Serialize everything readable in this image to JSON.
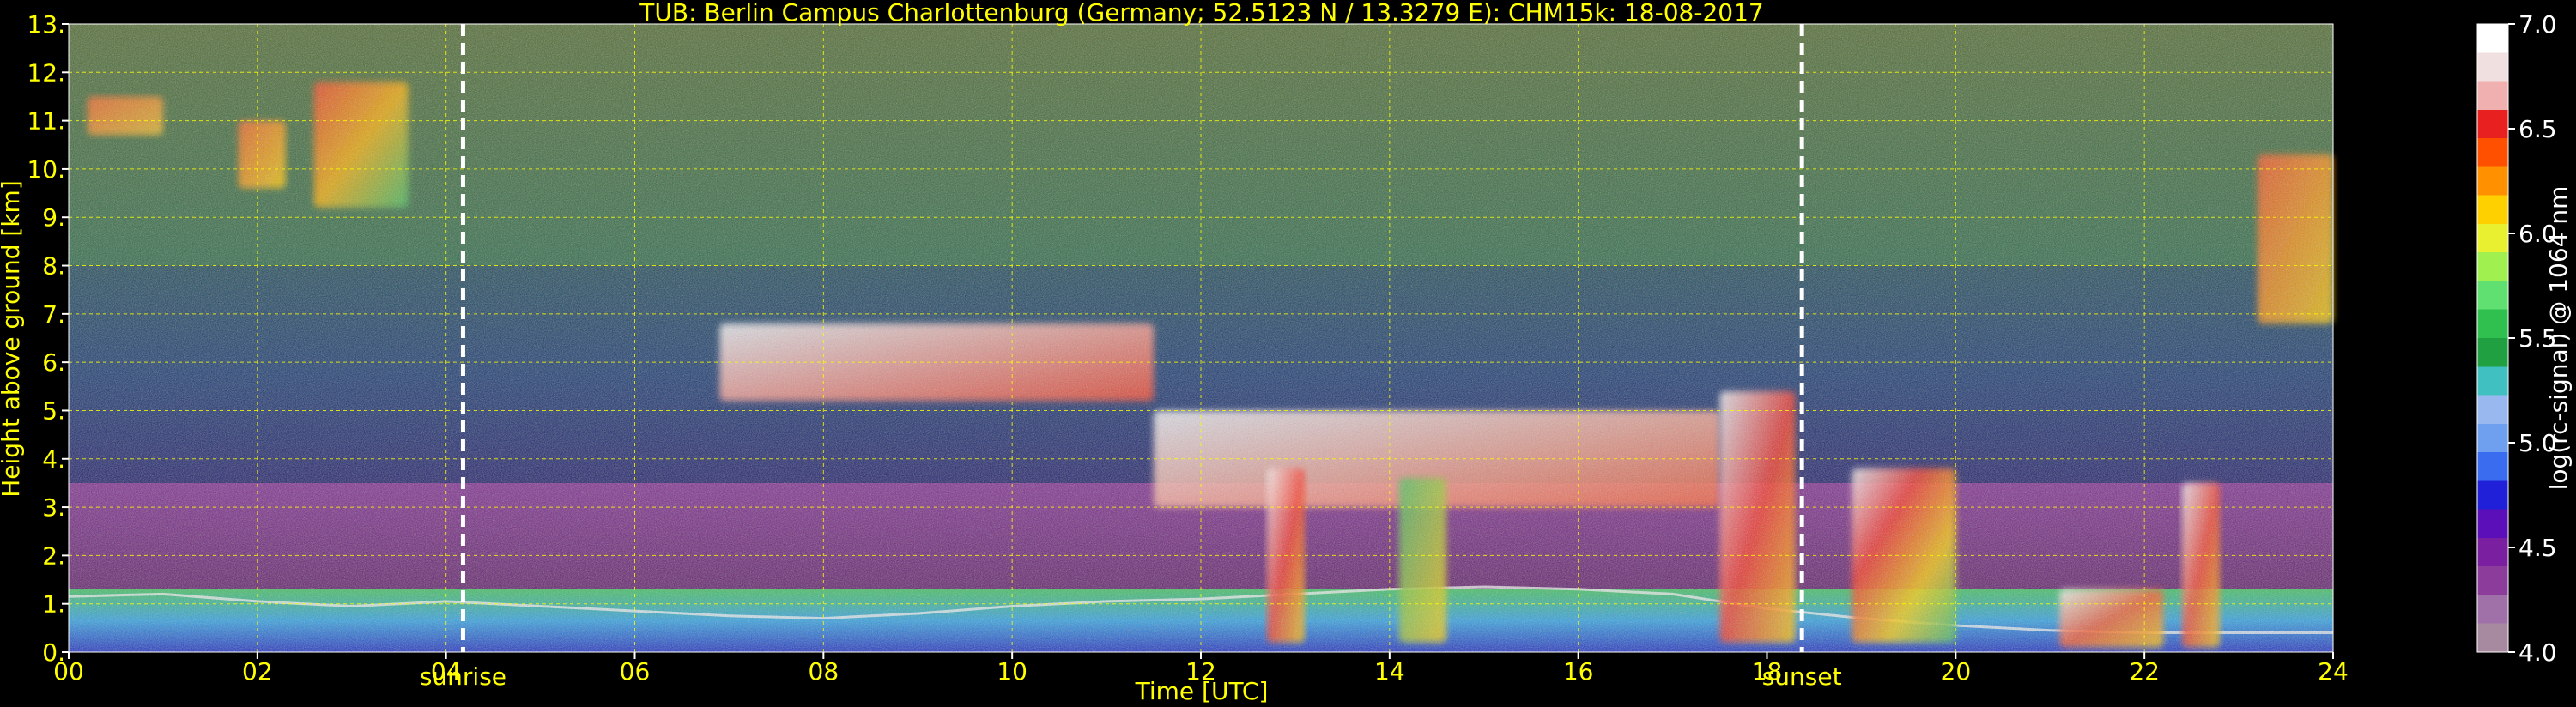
{
  "chart_data": {
    "type": "heatmap",
    "title": "TUB: Berlin Campus Charlottenburg (Germany; 52.5123 N / 13.3279 E):    CHM15k: 18-08-2017",
    "xlabel": "Time [UTC]",
    "ylabel": "Height above ground [km]",
    "xlim": [
      0,
      24
    ],
    "ylim": [
      0,
      13
    ],
    "x_ticks": [
      {
        "v": 0,
        "label": "00"
      },
      {
        "v": 2,
        "label": "02"
      },
      {
        "v": 4,
        "label": "04"
      },
      {
        "v": 6,
        "label": "06"
      },
      {
        "v": 8,
        "label": "08"
      },
      {
        "v": 10,
        "label": "10"
      },
      {
        "v": 12,
        "label": "12"
      },
      {
        "v": 14,
        "label": "14"
      },
      {
        "v": 16,
        "label": "16"
      },
      {
        "v": 18,
        "label": "18"
      },
      {
        "v": 20,
        "label": "20"
      },
      {
        "v": 22,
        "label": "22"
      },
      {
        "v": 24,
        "label": "24"
      }
    ],
    "y_ticks": [
      {
        "v": 0,
        "label": "0."
      },
      {
        "v": 1,
        "label": "1."
      },
      {
        "v": 2,
        "label": "2."
      },
      {
        "v": 3,
        "label": "3."
      },
      {
        "v": 4,
        "label": "4."
      },
      {
        "v": 5,
        "label": "5."
      },
      {
        "v": 6,
        "label": "6."
      },
      {
        "v": 7,
        "label": "7."
      },
      {
        "v": 8,
        "label": "8."
      },
      {
        "v": 9,
        "label": "9."
      },
      {
        "v": 10,
        "label": "10."
      },
      {
        "v": 11,
        "label": "11."
      },
      {
        "v": 12,
        "label": "12."
      },
      {
        "v": 13,
        "label": "13."
      }
    ],
    "grid": true,
    "grid_color": "#ffff00",
    "events": [
      {
        "name": "sunrise",
        "time": 4.18
      },
      {
        "name": "sunset",
        "time": 18.37
      }
    ],
    "colorbar": {
      "label": "log(rc-signal) @ 1064 nm",
      "range": [
        4.0,
        7.0
      ],
      "ticks": [
        {
          "v": 4.0,
          "label": "4.0"
        },
        {
          "v": 4.5,
          "label": "4.5"
        },
        {
          "v": 5.0,
          "label": "5.0"
        },
        {
          "v": 5.5,
          "label": "5.5"
        },
        {
          "v": 6.0,
          "label": "6.0"
        },
        {
          "v": 6.5,
          "label": "6.5"
        },
        {
          "v": 7.0,
          "label": "7.0"
        }
      ],
      "colors": [
        "#a88aa0",
        "#a070a8",
        "#8c3c9a",
        "#7a1fa0",
        "#5a0fb8",
        "#2020d8",
        "#3a6cf0",
        "#6fa0f0",
        "#9ab8f0",
        "#40c0c0",
        "#20a040",
        "#30c050",
        "#60e070",
        "#a0f050",
        "#e8f030",
        "#ffd000",
        "#ff9000",
        "#ff5000",
        "#e82020",
        "#f0b0b0",
        "#f0e0e0",
        "#ffffff"
      ]
    },
    "background_layers": [
      {
        "name": "boundary-layer",
        "y_range": [
          0,
          1.3
        ],
        "colors": [
          "#2030c0",
          "#30a0e0",
          "#40c060"
        ]
      },
      {
        "name": "residual-layer",
        "y_range": [
          1.3,
          3.5
        ],
        "colors": [
          "#60206a",
          "#803090"
        ]
      },
      {
        "name": "free-troposphere",
        "y_range": [
          3.5,
          8
        ],
        "colors": [
          "#20206a",
          "#1a3a70",
          "#204a5a"
        ]
      },
      {
        "name": "upper-noise",
        "y_range": [
          8,
          13
        ],
        "colors": [
          "#2e6a48",
          "#506a30"
        ]
      }
    ],
    "features": [
      {
        "name": "cirrus-early",
        "x": [
          0.2,
          1.0
        ],
        "y": [
          10.7,
          11.5
        ],
        "colors": [
          "#ff6020",
          "#f0c020"
        ]
      },
      {
        "name": "cirrus-early-2",
        "x": [
          1.8,
          2.3
        ],
        "y": [
          9.6,
          11.0
        ],
        "colors": [
          "#ff6020",
          "#ffd000"
        ]
      },
      {
        "name": "cirrus-early-3",
        "x": [
          2.6,
          3.6
        ],
        "y": [
          9.2,
          11.8
        ],
        "colors": [
          "#ff4020",
          "#ffb000",
          "#40c060"
        ]
      },
      {
        "name": "cloud-layer-mid",
        "x": [
          6.9,
          11.5
        ],
        "y": [
          5.2,
          6.8
        ],
        "colors": [
          "#ffffff",
          "#ff4020"
        ]
      },
      {
        "name": "cloud-layer-descending",
        "x": [
          11.5,
          17.5
        ],
        "y": [
          3.0,
          5.0
        ],
        "colors": [
          "#ffffff",
          "#ff6030"
        ]
      },
      {
        "name": "convective-cloud-13",
        "x": [
          12.7,
          13.1
        ],
        "y": [
          0.2,
          3.8
        ],
        "colors": [
          "#ffffff",
          "#ff3020",
          "#ffd000"
        ]
      },
      {
        "name": "convective-cloud-14",
        "x": [
          14.1,
          14.6
        ],
        "y": [
          0.2,
          3.6
        ],
        "colors": [
          "#40c060",
          "#ffd000"
        ]
      },
      {
        "name": "evening-convection",
        "x": [
          17.5,
          18.3
        ],
        "y": [
          0.2,
          5.4
        ],
        "colors": [
          "#ffffff",
          "#ff3020",
          "#ffd000"
        ]
      },
      {
        "name": "evening-convection-2",
        "x": [
          18.9,
          20.0
        ],
        "y": [
          0.2,
          3.8
        ],
        "colors": [
          "#ffffff",
          "#ff3020",
          "#ffd000",
          "#40c060"
        ]
      },
      {
        "name": "night-cloud-21-22",
        "x": [
          21.1,
          22.2
        ],
        "y": [
          0.1,
          1.3
        ],
        "colors": [
          "#ffffff",
          "#ff5020",
          "#ffd000"
        ]
      },
      {
        "name": "night-cloud-22",
        "x": [
          22.4,
          22.8
        ],
        "y": [
          0.1,
          3.5
        ],
        "colors": [
          "#ffffff",
          "#ff4020",
          "#ffd000"
        ]
      },
      {
        "name": "cirrus-late",
        "x": [
          23.2,
          24.0
        ],
        "y": [
          6.8,
          10.3
        ],
        "colors": [
          "#ff5020",
          "#ffd000"
        ]
      }
    ],
    "layer_top": [
      [
        0,
        1.15
      ],
      [
        1,
        1.2
      ],
      [
        2,
        1.05
      ],
      [
        3,
        0.95
      ],
      [
        4,
        1.05
      ],
      [
        5,
        0.95
      ],
      [
        6,
        0.85
      ],
      [
        7,
        0.75
      ],
      [
        8,
        0.7
      ],
      [
        9,
        0.8
      ],
      [
        10,
        0.95
      ],
      [
        11,
        1.05
      ],
      [
        12,
        1.1
      ],
      [
        13,
        1.2
      ],
      [
        14,
        1.3
      ],
      [
        15,
        1.35
      ],
      [
        16,
        1.3
      ],
      [
        17,
        1.2
      ],
      [
        18,
        0.9
      ],
      [
        19,
        0.7
      ],
      [
        20,
        0.55
      ],
      [
        21,
        0.45
      ],
      [
        22,
        0.4
      ],
      [
        23,
        0.4
      ],
      [
        24,
        0.4
      ]
    ]
  }
}
